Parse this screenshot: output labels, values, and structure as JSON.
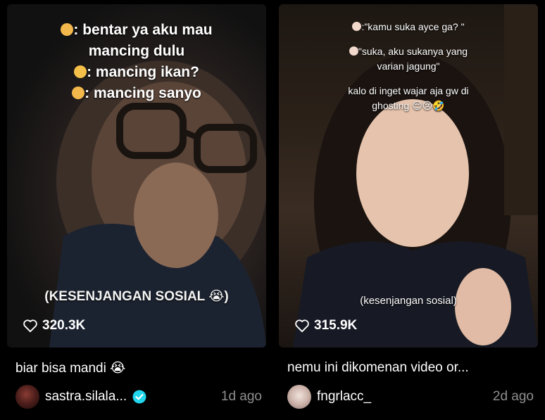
{
  "colors": {
    "background": "#000000",
    "verified_badge": "#20d5ec",
    "muted_text": "#8c8c8c"
  },
  "videos": [
    {
      "overlay_lines": [
        {
          "emoji": "man-emoji",
          "text": ": bentar ya aku mau"
        },
        {
          "emoji": "",
          "text": "mancing dulu"
        },
        {
          "emoji": "woman-emoji",
          "text": ": mancing ikan?"
        },
        {
          "emoji": "man-emoji",
          "text": ": mancing sanyo"
        }
      ],
      "overlay_tag": "(KESENJANGAN SOSIAL 😭)",
      "likes": "320.3K",
      "title": "biar bisa mandi 😭",
      "username": "sastra.silala...",
      "verified": true,
      "posted": "1d ago"
    },
    {
      "overlay_lines": [
        {
          "emoji": "girl-emoji",
          "text": ":\"kamu suka ayce ga? \""
        },
        {
          "emoji": "girl-emoji",
          "text": "\"suka, aku sukanya yang"
        },
        {
          "emoji": "",
          "text": "varian jagung\""
        },
        {
          "emoji": "",
          "text": "kalo di inget wajar aja gw di"
        },
        {
          "emoji": "",
          "text": "ghosting 😌😢🤣"
        }
      ],
      "overlay_tag": "(kesenjangan sosial)",
      "likes": "315.9K",
      "title": "nemu ini dikomenan video or...",
      "username": "fngrlacc_",
      "verified": false,
      "posted": "2d ago"
    }
  ]
}
